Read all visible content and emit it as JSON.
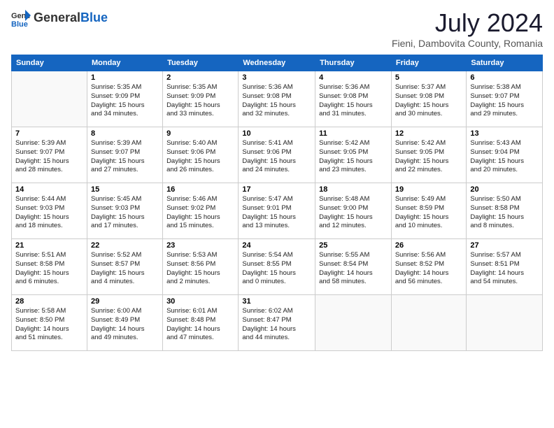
{
  "header": {
    "logo_general": "General",
    "logo_blue": "Blue",
    "month_year": "July 2024",
    "location": "Fieni, Dambovita County, Romania"
  },
  "weekdays": [
    "Sunday",
    "Monday",
    "Tuesday",
    "Wednesday",
    "Thursday",
    "Friday",
    "Saturday"
  ],
  "weeks": [
    [
      {
        "day": "",
        "content": ""
      },
      {
        "day": "1",
        "content": "Sunrise: 5:35 AM\nSunset: 9:09 PM\nDaylight: 15 hours\nand 34 minutes."
      },
      {
        "day": "2",
        "content": "Sunrise: 5:35 AM\nSunset: 9:09 PM\nDaylight: 15 hours\nand 33 minutes."
      },
      {
        "day": "3",
        "content": "Sunrise: 5:36 AM\nSunset: 9:08 PM\nDaylight: 15 hours\nand 32 minutes."
      },
      {
        "day": "4",
        "content": "Sunrise: 5:36 AM\nSunset: 9:08 PM\nDaylight: 15 hours\nand 31 minutes."
      },
      {
        "day": "5",
        "content": "Sunrise: 5:37 AM\nSunset: 9:08 PM\nDaylight: 15 hours\nand 30 minutes."
      },
      {
        "day": "6",
        "content": "Sunrise: 5:38 AM\nSunset: 9:07 PM\nDaylight: 15 hours\nand 29 minutes."
      }
    ],
    [
      {
        "day": "7",
        "content": "Sunrise: 5:39 AM\nSunset: 9:07 PM\nDaylight: 15 hours\nand 28 minutes."
      },
      {
        "day": "8",
        "content": "Sunrise: 5:39 AM\nSunset: 9:07 PM\nDaylight: 15 hours\nand 27 minutes."
      },
      {
        "day": "9",
        "content": "Sunrise: 5:40 AM\nSunset: 9:06 PM\nDaylight: 15 hours\nand 26 minutes."
      },
      {
        "day": "10",
        "content": "Sunrise: 5:41 AM\nSunset: 9:06 PM\nDaylight: 15 hours\nand 24 minutes."
      },
      {
        "day": "11",
        "content": "Sunrise: 5:42 AM\nSunset: 9:05 PM\nDaylight: 15 hours\nand 23 minutes."
      },
      {
        "day": "12",
        "content": "Sunrise: 5:42 AM\nSunset: 9:05 PM\nDaylight: 15 hours\nand 22 minutes."
      },
      {
        "day": "13",
        "content": "Sunrise: 5:43 AM\nSunset: 9:04 PM\nDaylight: 15 hours\nand 20 minutes."
      }
    ],
    [
      {
        "day": "14",
        "content": "Sunrise: 5:44 AM\nSunset: 9:03 PM\nDaylight: 15 hours\nand 18 minutes."
      },
      {
        "day": "15",
        "content": "Sunrise: 5:45 AM\nSunset: 9:03 PM\nDaylight: 15 hours\nand 17 minutes."
      },
      {
        "day": "16",
        "content": "Sunrise: 5:46 AM\nSunset: 9:02 PM\nDaylight: 15 hours\nand 15 minutes."
      },
      {
        "day": "17",
        "content": "Sunrise: 5:47 AM\nSunset: 9:01 PM\nDaylight: 15 hours\nand 13 minutes."
      },
      {
        "day": "18",
        "content": "Sunrise: 5:48 AM\nSunset: 9:00 PM\nDaylight: 15 hours\nand 12 minutes."
      },
      {
        "day": "19",
        "content": "Sunrise: 5:49 AM\nSunset: 8:59 PM\nDaylight: 15 hours\nand 10 minutes."
      },
      {
        "day": "20",
        "content": "Sunrise: 5:50 AM\nSunset: 8:58 PM\nDaylight: 15 hours\nand 8 minutes."
      }
    ],
    [
      {
        "day": "21",
        "content": "Sunrise: 5:51 AM\nSunset: 8:58 PM\nDaylight: 15 hours\nand 6 minutes."
      },
      {
        "day": "22",
        "content": "Sunrise: 5:52 AM\nSunset: 8:57 PM\nDaylight: 15 hours\nand 4 minutes."
      },
      {
        "day": "23",
        "content": "Sunrise: 5:53 AM\nSunset: 8:56 PM\nDaylight: 15 hours\nand 2 minutes."
      },
      {
        "day": "24",
        "content": "Sunrise: 5:54 AM\nSunset: 8:55 PM\nDaylight: 15 hours\nand 0 minutes."
      },
      {
        "day": "25",
        "content": "Sunrise: 5:55 AM\nSunset: 8:54 PM\nDaylight: 14 hours\nand 58 minutes."
      },
      {
        "day": "26",
        "content": "Sunrise: 5:56 AM\nSunset: 8:52 PM\nDaylight: 14 hours\nand 56 minutes."
      },
      {
        "day": "27",
        "content": "Sunrise: 5:57 AM\nSunset: 8:51 PM\nDaylight: 14 hours\nand 54 minutes."
      }
    ],
    [
      {
        "day": "28",
        "content": "Sunrise: 5:58 AM\nSunset: 8:50 PM\nDaylight: 14 hours\nand 51 minutes."
      },
      {
        "day": "29",
        "content": "Sunrise: 6:00 AM\nSunset: 8:49 PM\nDaylight: 14 hours\nand 49 minutes."
      },
      {
        "day": "30",
        "content": "Sunrise: 6:01 AM\nSunset: 8:48 PM\nDaylight: 14 hours\nand 47 minutes."
      },
      {
        "day": "31",
        "content": "Sunrise: 6:02 AM\nSunset: 8:47 PM\nDaylight: 14 hours\nand 44 minutes."
      },
      {
        "day": "",
        "content": ""
      },
      {
        "day": "",
        "content": ""
      },
      {
        "day": "",
        "content": ""
      }
    ]
  ]
}
